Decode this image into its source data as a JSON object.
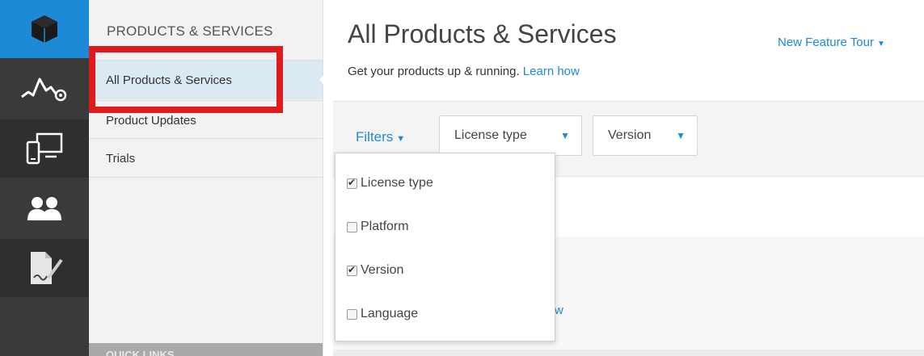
{
  "rail": {
    "items": [
      {
        "icon": "cube-icon",
        "active": true
      },
      {
        "icon": "activity-icon",
        "active": false
      },
      {
        "icon": "devices-icon",
        "active": false
      },
      {
        "icon": "users-icon",
        "active": false
      },
      {
        "icon": "document-sign-icon",
        "active": false
      }
    ]
  },
  "nav": {
    "heading": "PRODUCTS & SERVICES",
    "items": [
      {
        "label": "All Products & Services",
        "selected": true
      },
      {
        "label": "Product Updates",
        "selected": false
      },
      {
        "label": "Trials",
        "selected": false
      }
    ],
    "footer": "QUICK LINKS"
  },
  "header": {
    "title": "All Products & Services",
    "subtitle": "Get your products up & running.",
    "learn_link": "Learn how",
    "feature_tour": "New Feature Tour",
    "caret": "▼"
  },
  "filters": {
    "label": "Filters",
    "dropdowns": [
      {
        "label": "License type"
      },
      {
        "label": "Version"
      }
    ],
    "menu": [
      {
        "label": "License type",
        "checked": true
      },
      {
        "label": "Platform",
        "checked": false
      },
      {
        "label": "Version",
        "checked": true
      },
      {
        "label": "Language",
        "checked": false
      }
    ]
  },
  "content": {
    "partial_text": "w"
  },
  "colors": {
    "accent": "#1c8ad6",
    "highlight": "#e01b1b",
    "rail_bg": "#3a3a3a"
  }
}
